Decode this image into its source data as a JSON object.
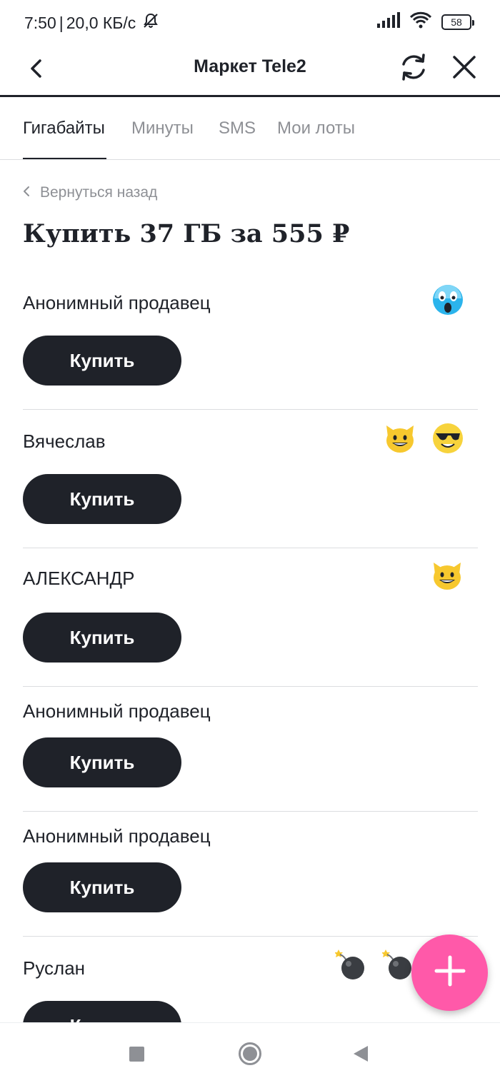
{
  "status_bar": {
    "time": "7:50",
    "separator": "|",
    "network_speed": "20,0 КБ/с",
    "battery": "58"
  },
  "header": {
    "title": "Маркет Tele2"
  },
  "tabs": [
    {
      "label": "Гигабайты",
      "active": true
    },
    {
      "label": "Минуты",
      "active": false
    },
    {
      "label": "SMS",
      "active": false
    },
    {
      "label": "Мои лоты",
      "active": false
    }
  ],
  "back_link": {
    "label": "Вернуться назад"
  },
  "page_title": "Купить 37 ГБ за 555 ₽",
  "buy_label": "Купить",
  "sellers": [
    {
      "name": "Анонимный продавец",
      "emojis": [
        "scream-face"
      ]
    },
    {
      "name": "Вячеслав",
      "emojis": [
        "grinning-cat",
        "cool-face"
      ]
    },
    {
      "name": "АЛЕКСАНДР",
      "emojis": [
        "grinning-cat"
      ]
    },
    {
      "name": "Анонимный продавец",
      "emojis": []
    },
    {
      "name": "Анонимный продавец",
      "emojis": []
    },
    {
      "name": "Руслан",
      "emojis": [
        "bomb",
        "bomb"
      ]
    }
  ],
  "icons": {
    "back": "chevron-left-icon",
    "refresh": "refresh-icon",
    "close": "close-icon",
    "fab": "plus-icon"
  },
  "colors": {
    "text": "#1f2229",
    "muted": "#8e9095",
    "button": "#1f2229",
    "fab": "#ff59a9",
    "divider": "#dcdde0"
  }
}
